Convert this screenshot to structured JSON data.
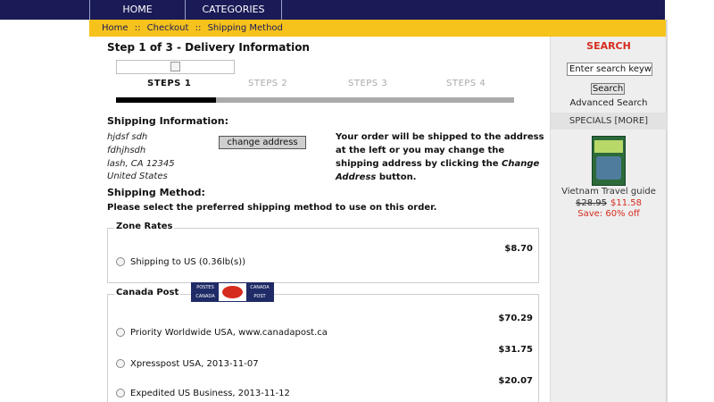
{
  "nav": {
    "home": "HOME",
    "categories": "CATEGORIES"
  },
  "breadcrumb": {
    "home": "Home",
    "sep1": "::",
    "checkout": "Checkout",
    "sep2": "::",
    "current": "Shipping Method"
  },
  "step": {
    "title": "Step 1 of 3 - Delivery Information",
    "labels": [
      "STEPS 1",
      "STEPS 2",
      "STEPS 3",
      "STEPS 4"
    ],
    "progress_fraction": 0.25
  },
  "shipping_info": {
    "heading": "Shipping Information:",
    "address": [
      "hjdsf sdh",
      "fdhjhsdh",
      "lash, CA 12345",
      "United States"
    ],
    "change_button": "change address",
    "note_part1": "Your order will be shipped to the address at the left or you may change the shipping address by clicking the ",
    "note_link": "Change Address",
    "note_part2": " button."
  },
  "shipping_method": {
    "heading": "Shipping Method:",
    "instruction": "Please select the preferred shipping method to use on this order.",
    "groups": [
      {
        "name": "Zone Rates",
        "options": [
          {
            "label": "Shipping to US (0.36lb(s))",
            "price": "$8.70"
          }
        ]
      },
      {
        "name": "Canada Post",
        "logo_text": {
          "top_left": "POSTES",
          "top_right": "CANADA",
          "bottom_left": "CANADA",
          "bottom_right": "POST"
        },
        "options": [
          {
            "label": "Priority Worldwide USA, www.canadapost.ca",
            "price": "$70.29"
          },
          {
            "label": "Xpresspost USA, 2013-11-07",
            "price": "$31.75"
          },
          {
            "label": "Expedited US Business, 2013-11-12",
            "price": "$20.07"
          }
        ]
      }
    ]
  },
  "sidebar": {
    "search_title": "SEARCH",
    "search_placeholder": "Enter search keywords here",
    "search_button": "Search",
    "advanced": "Advanced Search",
    "specials": "SPECIALS",
    "more": "[MORE]",
    "product": {
      "name": "Vietnam Travel guide",
      "old_price": "$28.95",
      "new_price": "$11.58",
      "save": "Save: 60% off"
    }
  },
  "colors": {
    "nav_bg": "#1a1a57",
    "breadcrumb_bg": "#f6c21c",
    "accent_red": "#d52b1e",
    "sidebar_bg": "#eeeeee"
  }
}
